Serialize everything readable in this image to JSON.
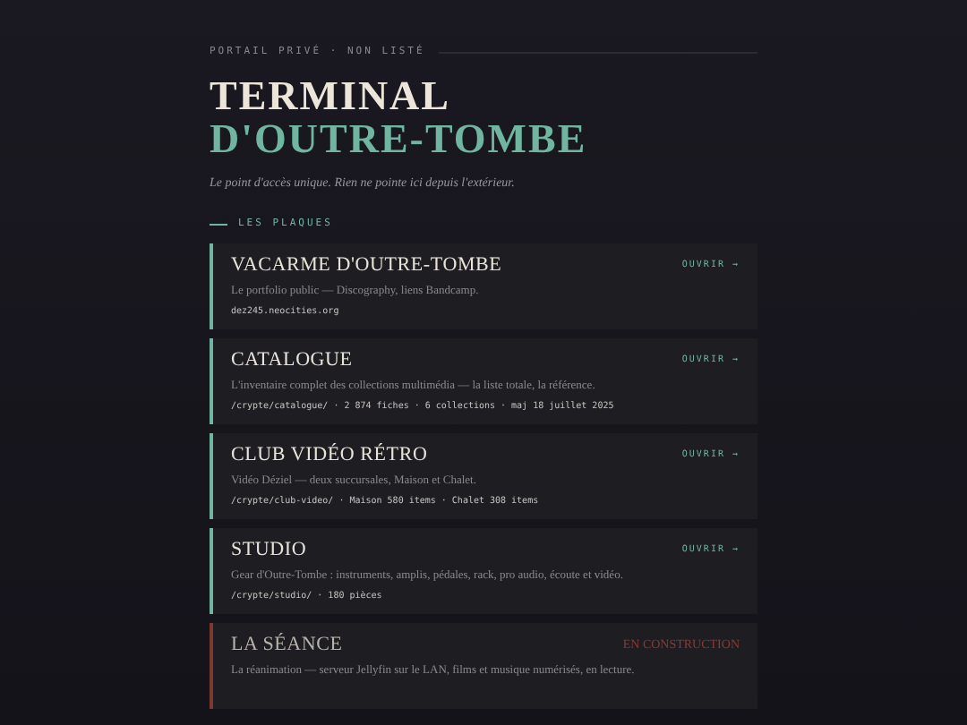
{
  "header": {
    "eyebrow": "PORTAIL PRIVÉ · NON LISTÉ",
    "title": "TERMINAL",
    "title_accent": "D'OUTRE-TOMBE",
    "tagline": "Le point d'accès unique. Rien ne pointe ici depuis l'extérieur."
  },
  "section": {
    "label": "LES PLAQUES"
  },
  "cards": [
    {
      "kind": "open",
      "title": "VACARME D'OUTRE-TOMBE",
      "action": "OUVRIR →",
      "description": "Le portfolio public — Discography, liens Bandcamp.",
      "meta": "dez245.neocities.org"
    },
    {
      "kind": "open",
      "title": "CATALOGUE",
      "action": "OUVRIR →",
      "description": "L'inventaire complet des collections multimédia — la liste totale, la référence.",
      "meta": "/crypte/catalogue/ · 2 874 fiches · 6 collections · maj 18 juillet 2025"
    },
    {
      "kind": "open",
      "title": "CLUB VIDÉO RÉTRO",
      "action": "OUVRIR →",
      "description": "Vidéo Déziel — deux succursales, Maison et Chalet.",
      "meta": "/crypte/club-video/ · Maison 580 items · Chalet 308 items"
    },
    {
      "kind": "open",
      "title": "STUDIO",
      "action": "OUVRIR →",
      "description": "Gear d'Outre-Tombe : instruments, amplis, pédales, rack, pro audio, écoute et vidéo.",
      "meta": "/crypte/studio/ · 180 pièces"
    },
    {
      "kind": "construction",
      "title": "LA SÉANCE",
      "action": "EN CONSTRUCTION",
      "description": "La réanimation — serveur Jellyfin sur le LAN, films et musique numérisés, en lecture."
    }
  ]
}
